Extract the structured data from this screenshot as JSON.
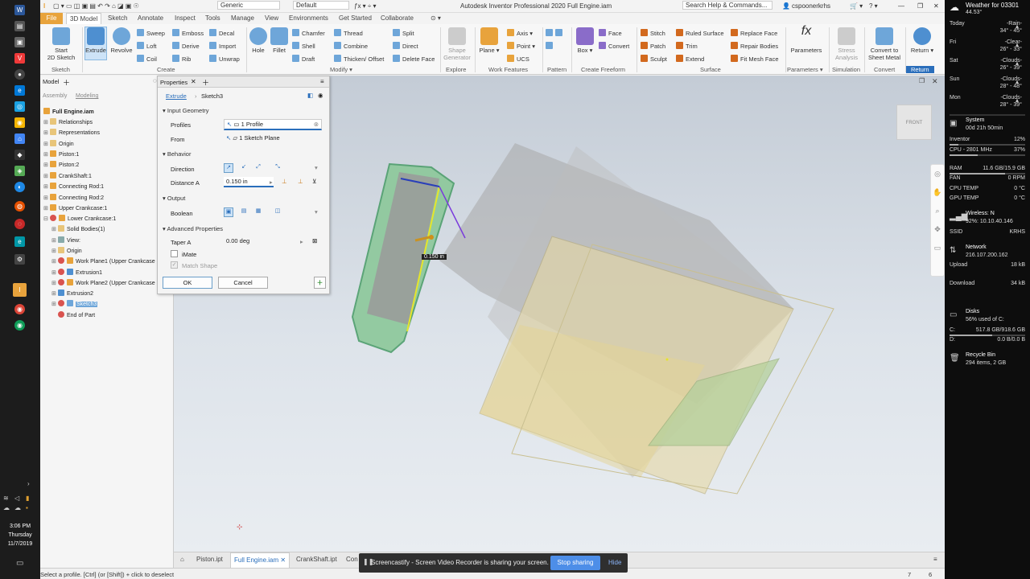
{
  "taskbar": {
    "icons": [
      "word-icon",
      "ppt-icon",
      "app-icon",
      "vivaldi-icon",
      "dev-icon",
      "edge-icon",
      "game-icon",
      "chrome-icon",
      "git-icon",
      "dev2-icon",
      "odoo-icon",
      "camera-icon",
      "media-icon",
      "inventor-icon",
      "chrome2-icon",
      "chrome3-icon"
    ]
  },
  "clock": {
    "time": "3:06 PM",
    "day": "Thursday",
    "date": "11/7/2019"
  },
  "titlebar": {
    "app": "Autodesk Inventor Professional 2020   Full Engine.iam",
    "search": "Search Help & Commands...",
    "user": "cspoonerkrhs",
    "appearance": "Generic",
    "style": "Default"
  },
  "ribbon_tabs": [
    "File",
    "3D Model",
    "Sketch",
    "Annotate",
    "Inspect",
    "Tools",
    "Manage",
    "View",
    "Environments",
    "Get Started",
    "Collaborate"
  ],
  "ribbon": {
    "start_sketch": "Start\n2D Sketch",
    "extrude": "Extrude",
    "revolve": "Revolve",
    "sweep": "Sweep",
    "loft": "Loft",
    "coil": "Coil",
    "emboss": "Emboss",
    "derive": "Derive",
    "rib": "Rib",
    "decal": "Decal",
    "import": "Import",
    "unwrap": "Unwrap",
    "hole": "Hole",
    "fillet": "Fillet",
    "chamfer": "Chamfer",
    "shell": "Shell",
    "draft": "Draft",
    "thread": "Thread",
    "combine": "Combine",
    "thicken": "Thicken/ Offset",
    "split": "Split",
    "direct": "Direct",
    "delete_face": "Delete Face",
    "shape_generator": "Shape\nGenerator",
    "plane": "Plane",
    "axis": "Axis",
    "point": "Point",
    "ucs": "UCS",
    "box": "Box",
    "face": "Face",
    "convert": "Convert",
    "stitch": "Stitch",
    "patch": "Patch",
    "sculpt": "Sculpt",
    "ruled_surface": "Ruled Surface",
    "trim": "Trim",
    "extend": "Extend",
    "replace_face": "Replace Face",
    "repair_bodies": "Repair Bodies",
    "fit_mesh_face": "Fit Mesh Face",
    "parameters": "Parameters",
    "stress_analysis": "Stress\nAnalysis",
    "convert_sheet_metal": "Convert to\nSheet Metal",
    "return": "Return",
    "groups": {
      "sketch": "Sketch",
      "create": "Create",
      "modify": "Modify",
      "explore": "Explore",
      "work_features": "Work Features",
      "pattern": "Pattern",
      "create_freeform": "Create Freeform",
      "surface": "Surface",
      "parameters": "Parameters",
      "simulation": "Simulation",
      "convert": "Convert",
      "return": "Return"
    }
  },
  "browser": {
    "tab_model": "Model",
    "assembly": "Assembly",
    "modeling": "Modeling",
    "items": [
      "Full Engine.iam",
      "Relationships",
      "Representations",
      "Origin",
      "Piston:1",
      "Piston:2",
      "CrankShaft:1",
      "Connecting Rod:1",
      "Connecting Rod:2",
      "Upper Crankcase:1",
      "Lower Crankcase:1",
      "Solid Bodies(1)",
      "View:",
      "Origin",
      "Work Plane1 (Upper Crankcase",
      "Extrusion1",
      "Work Plane2 (Upper Crankcase",
      "Extrusion2",
      "Sketch3",
      "End of Part"
    ]
  },
  "props": {
    "tab": "Properties",
    "crumb_feature": "Extrude",
    "crumb_sketch": "Sketch3",
    "section_input": "Input Geometry",
    "profiles_label": "Profiles",
    "profiles_value": "1 Profile",
    "from_label": "From",
    "from_value": "1 Sketch Plane",
    "section_behavior": "Behavior",
    "direction_label": "Direction",
    "distance_label": "Distance A",
    "distance_value": "0.150 in",
    "section_output": "Output",
    "boolean_label": "Boolean",
    "section_advanced": "Advanced Properties",
    "taper_label": "Taper A",
    "taper_value": "0.00 deg",
    "imate": "iMate",
    "match_shape": "Match Shape",
    "ok": "OK",
    "cancel": "Cancel"
  },
  "viewport": {
    "dimension": "0.150 in",
    "viewcube": "FRONT"
  },
  "doc_tabs": [
    "Piston.ipt",
    "Full Engine.iam",
    "CrankShaft.ipt",
    "Con"
  ],
  "status": {
    "message": "Select a profile. [Ctrl] (or [Shift]) + click to deselect",
    "n1": "7",
    "n2": "6"
  },
  "share": {
    "message": "Screencastify - Screen Video Recorder is sharing your screen.",
    "stop": "Stop sharing",
    "hide": "Hide"
  },
  "sidebar": {
    "weather_title": "Weather for 03301",
    "weather_temp": "44.53°",
    "forecast": [
      {
        "day": "Today",
        "cond": "-Rain-",
        "temp": "34° - 45°"
      },
      {
        "day": "Fri",
        "cond": "-Clear-",
        "temp": "26° - 33°"
      },
      {
        "day": "Sat",
        "cond": "-Clouds-",
        "temp": "26° - 39°"
      },
      {
        "day": "Sun",
        "cond": "-Clouds-",
        "temp": "28° - 48°"
      },
      {
        "day": "Mon",
        "cond": "-Clouds-",
        "temp": "28° - 39°"
      }
    ],
    "system_title": "System",
    "uptime": "00d 21h 50min",
    "rows": [
      {
        "k": "Inventor",
        "v": "12%"
      },
      {
        "k": "CPU - 2801 MHz",
        "v": "37%"
      },
      {
        "k": "RAM",
        "v": "11.6 GB/15.9 GB"
      },
      {
        "k": "FAN",
        "v": "0 RPM"
      },
      {
        "k": "CPU TEMP",
        "v": "0 °C"
      },
      {
        "k": "GPU TEMP",
        "v": "0 °C"
      }
    ],
    "wireless": "Wireless: N",
    "wireless_info": "92%: 10.10.40.146",
    "ssid_label": "SSID",
    "ssid": "KRHS",
    "network": "Network",
    "network_ip": "216.107.200.162",
    "upload_label": "Upload",
    "upload": "18 kB",
    "download_label": "Download",
    "download": "34 kB",
    "disks": "Disks",
    "disk_info": "56% used of C:",
    "c_label": "C:",
    "c_value": "517.8 GB/918.6 GB",
    "d_label": "D:",
    "d_value": "0.0 B/0.0 B",
    "recycle": "Recycle Bin",
    "recycle_info": "294  items, 2 GB",
    "ram_fill": 0.73,
    "cpu_fill": 0.37,
    "inv_fill": 0.12,
    "disk_fill": 0.56
  }
}
